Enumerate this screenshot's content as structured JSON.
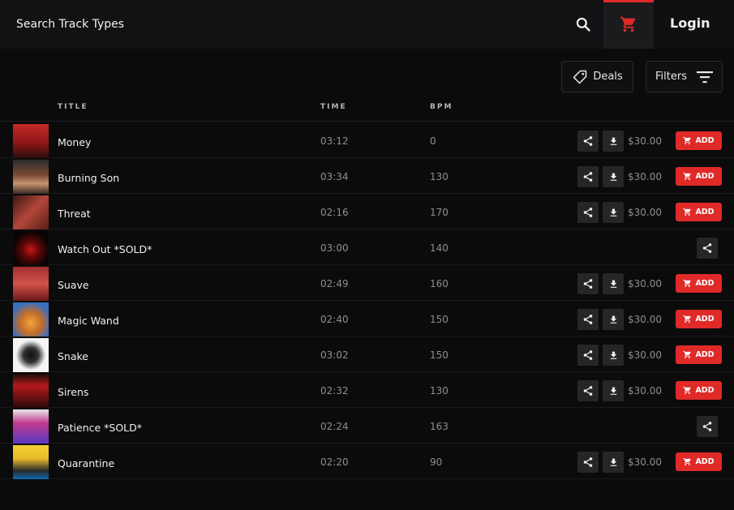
{
  "header": {
    "search_placeholder": "Search Track Types",
    "search_icon": "search-icon",
    "cart_icon": "cart-icon",
    "login_label": "Login",
    "accent_color": "#e02a28"
  },
  "toolbar": {
    "deals_label": "Deals",
    "filters_label": "Filters"
  },
  "columns": {
    "title": "TITLE",
    "time": "TIME",
    "bpm": "BPM"
  },
  "tracks": [
    {
      "title": "Money",
      "time": "03:12",
      "bpm": "0",
      "price": "$30.00",
      "add": "ADD",
      "sold": false
    },
    {
      "title": "Burning Son",
      "time": "03:34",
      "bpm": "130",
      "price": "$30.00",
      "add": "ADD",
      "sold": false
    },
    {
      "title": "Threat",
      "time": "02:16",
      "bpm": "170",
      "price": "$30.00",
      "add": "ADD",
      "sold": false
    },
    {
      "title": "Watch Out *SOLD*",
      "time": "03:00",
      "bpm": "140",
      "price": "",
      "add": "",
      "sold": true
    },
    {
      "title": "Suave",
      "time": "02:49",
      "bpm": "160",
      "price": "$30.00",
      "add": "ADD",
      "sold": false
    },
    {
      "title": "Magic Wand",
      "time": "02:40",
      "bpm": "150",
      "price": "$30.00",
      "add": "ADD",
      "sold": false
    },
    {
      "title": "Snake",
      "time": "03:02",
      "bpm": "150",
      "price": "$30.00",
      "add": "ADD",
      "sold": false
    },
    {
      "title": "Sirens",
      "time": "02:32",
      "bpm": "130",
      "price": "$30.00",
      "add": "ADD",
      "sold": false
    },
    {
      "title": "Patience *SOLD*",
      "time": "02:24",
      "bpm": "163",
      "price": "",
      "add": "",
      "sold": true
    },
    {
      "title": "Quarantine",
      "time": "02:20",
      "bpm": "90",
      "price": "$30.00",
      "add": "ADD",
      "sold": false
    }
  ]
}
